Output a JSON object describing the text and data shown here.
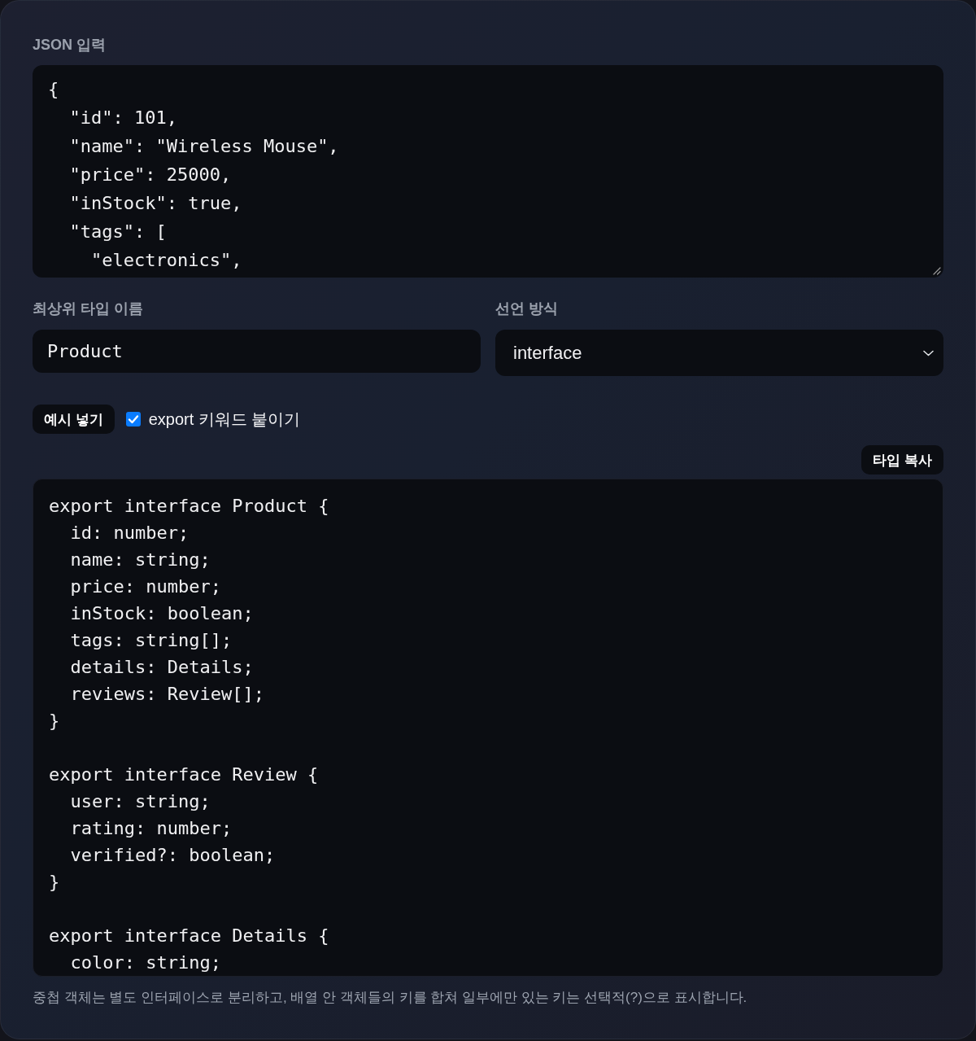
{
  "json_input": {
    "label": "JSON 입력",
    "lines": [
      "{",
      "  \"id\": 101,",
      "  \"name\": \"Wireless Mouse\",",
      "  \"price\": 25000,",
      "  \"inStock\": true,",
      "  \"tags\": [",
      "    \"electronics\","
    ]
  },
  "type_name": {
    "label": "최상위 타입 이름",
    "value": "Product"
  },
  "declaration": {
    "label": "선언 방식",
    "value": "interface"
  },
  "example_button": "예시 넣기",
  "export_option": {
    "label": "export 키워드 붙이기",
    "checked": true
  },
  "copy_button": "타입 복사",
  "output": {
    "blocks": [
      {
        "lines": [
          "export interface Product {",
          "  id: number;",
          "  name: string;",
          "  price: number;",
          "  inStock: boolean;",
          "  tags: string[];",
          "  details: Details;",
          "  reviews: Review[];",
          "}"
        ]
      },
      {
        "lines": [
          "export interface Review {",
          "  user: string;",
          "  rating: number;",
          "  verified?: boolean;",
          "}"
        ]
      },
      {
        "lines": [
          "export interface Details {",
          "  color: string;"
        ]
      }
    ]
  },
  "caption": "중첩 객체는 별도 인터페이스로 분리하고, 배열 안 객체들의 키를 합쳐 일부에만 있는 키는 선택적(?)으로 표시합니다."
}
